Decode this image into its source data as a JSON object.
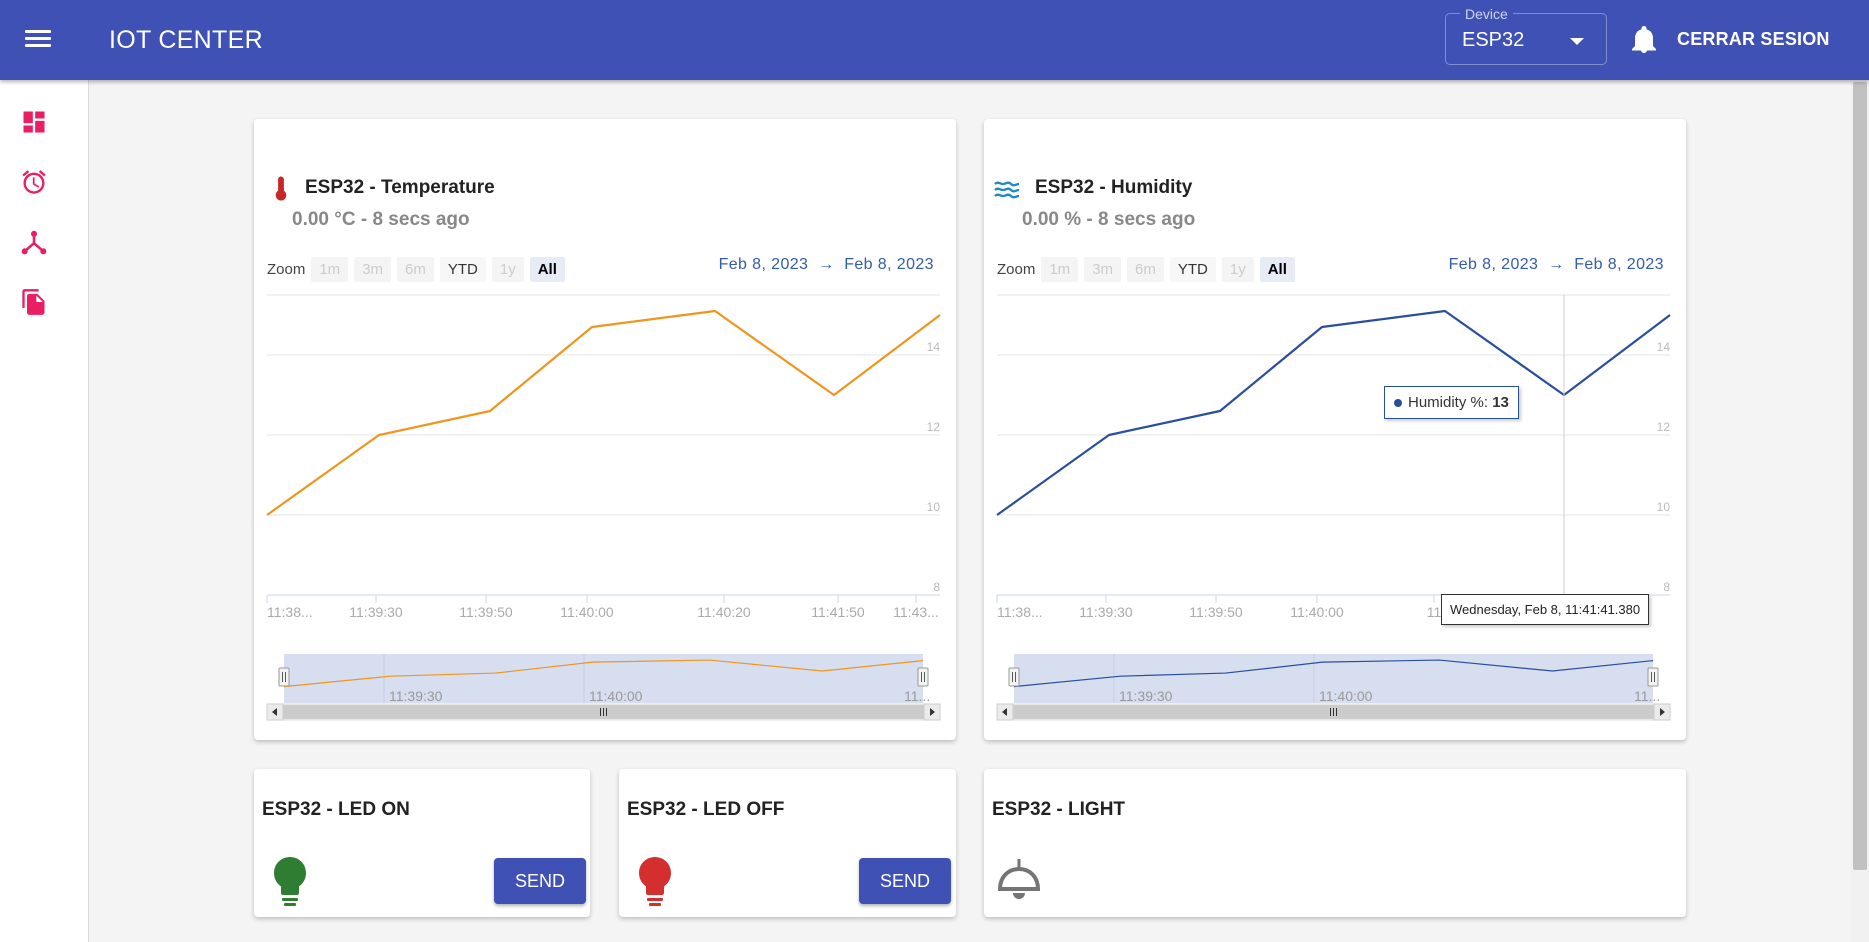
{
  "app": {
    "title": "IOT CENTER",
    "device_label": "Device",
    "device_value": "ESP32",
    "logout_label": "CERRAR SESION"
  },
  "sidebar": {
    "items": [
      {
        "icon": "dashboard-icon"
      },
      {
        "icon": "alarm-icon"
      },
      {
        "icon": "hub-icon"
      },
      {
        "icon": "files-icon"
      }
    ]
  },
  "temperature_card": {
    "title": "ESP32 - Temperature",
    "subtitle": "0.00 °C - 8 secs ago",
    "icon": "thermometer-icon",
    "zoom": {
      "label": "Zoom",
      "buttons": [
        {
          "label": "1m",
          "state": "disabled"
        },
        {
          "label": "3m",
          "state": "disabled"
        },
        {
          "label": "6m",
          "state": "disabled"
        },
        {
          "label": "YTD",
          "state": "enabled"
        },
        {
          "label": "1y",
          "state": "disabled"
        },
        {
          "label": "All",
          "state": "selected"
        }
      ]
    },
    "range_from": "Feb 8, 2023",
    "range_arrow": "→",
    "range_to": "Feb 8, 2023"
  },
  "humidity_card": {
    "title": "ESP32 - Humidity",
    "subtitle": "0.00 % - 8 secs ago",
    "icon": "waves-icon",
    "zoom": {
      "label": "Zoom",
      "buttons": [
        {
          "label": "1m",
          "state": "disabled"
        },
        {
          "label": "3m",
          "state": "disabled"
        },
        {
          "label": "6m",
          "state": "disabled"
        },
        {
          "label": "YTD",
          "state": "enabled"
        },
        {
          "label": "1y",
          "state": "disabled"
        },
        {
          "label": "All",
          "state": "selected"
        }
      ]
    },
    "range_from": "Feb 8, 2023",
    "range_arrow": "→",
    "range_to": "Feb 8, 2023",
    "tooltip": {
      "series_label": "Humidity %:",
      "value": "13"
    },
    "date_tooltip": "Wednesday, Feb 8, 11:41:41.380"
  },
  "led_on_card": {
    "title": "ESP32 - LED ON",
    "button_label": "SEND",
    "bulb_color": "#2e7d32"
  },
  "led_off_card": {
    "title": "ESP32 - LED OFF",
    "button_label": "SEND",
    "bulb_color": "#d32f2f"
  },
  "light_card": {
    "title": "ESP32 - LIGHT",
    "icon": "ceiling-lamp-icon"
  },
  "colors": {
    "primary": "#3f51b5",
    "accent": "#e91e63",
    "temperature_line": "#f0951e",
    "humidity_line": "#2a4e9e",
    "navigator_fill": "#d0d8ec"
  },
  "chart_data": [
    {
      "type": "line",
      "series": [
        {
          "name": "",
          "values": [
            10,
            12,
            12.6,
            14.7,
            15.1,
            13,
            15
          ]
        }
      ],
      "ylim": [
        8,
        15.5
      ],
      "y_ticks": [
        "14",
        "12",
        "10",
        "8"
      ],
      "x_ticks": [
        "11:38...",
        "11:39:30",
        "11:39:50",
        "11:40:00",
        "11:40:20",
        "11:41:50",
        "11:43..."
      ],
      "navigator_ticks": [
        "11:39:30",
        "11:40:00",
        "11..."
      ],
      "grid": true
    },
    {
      "type": "line",
      "series": [
        {
          "name": "Humidity %",
          "values": [
            10,
            12,
            12.6,
            14.7,
            15.1,
            13,
            15
          ]
        }
      ],
      "ylim": [
        8,
        15.5
      ],
      "y_ticks": [
        "14",
        "12",
        "10",
        "8"
      ],
      "x_ticks": [
        "11:38...",
        "11:39:30",
        "11:39:50",
        "11:40:00",
        "11"
      ],
      "navigator_ticks": [
        "11:39:30",
        "11:40:00",
        "11..."
      ],
      "grid": true
    }
  ]
}
